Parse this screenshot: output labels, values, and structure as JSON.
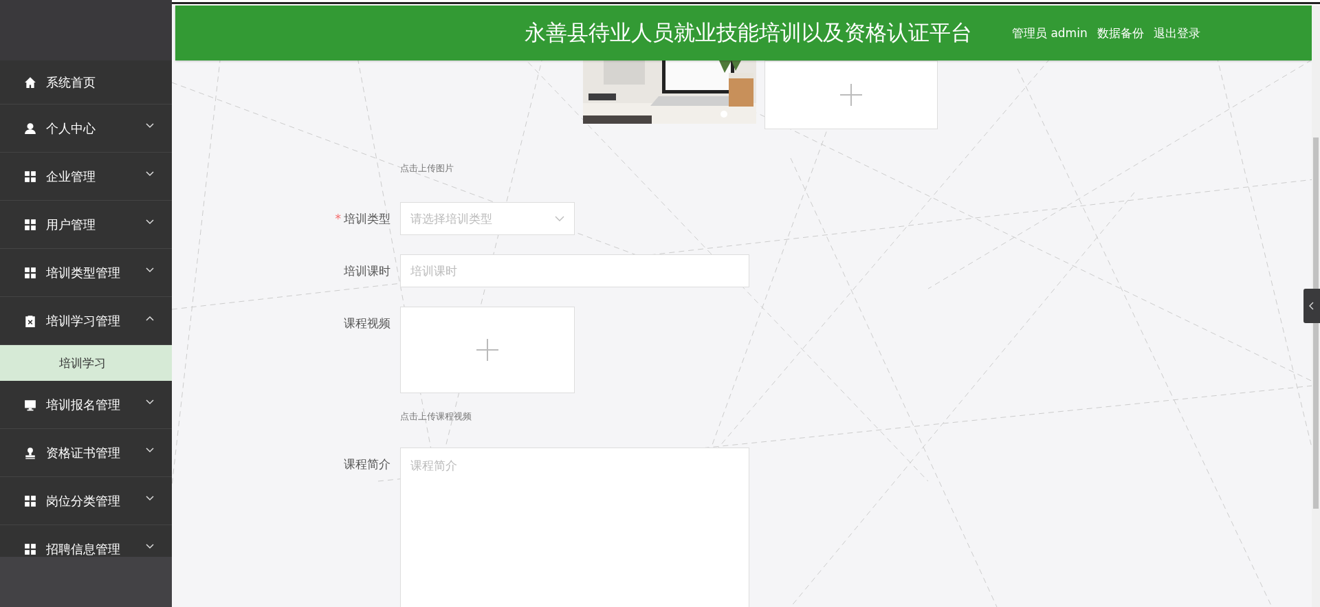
{
  "header": {
    "title": "永善县待业人员就业技能培训以及资格认证平台",
    "links": [
      "管理员 admin",
      "数据备份",
      "退出登录"
    ]
  },
  "sidebar": {
    "items": [
      {
        "label": "系统首页",
        "kind": "home"
      },
      {
        "label": "个人中心",
        "kind": "user",
        "expanded": false
      },
      {
        "label": "企业管理",
        "kind": "grid",
        "expanded": false
      },
      {
        "label": "用户管理",
        "kind": "grid",
        "expanded": false
      },
      {
        "label": "培训类型管理",
        "kind": "grid",
        "expanded": false
      },
      {
        "label": "培训学习管理",
        "kind": "clipboard",
        "expanded": true,
        "children": [
          {
            "label": "培训学习",
            "selected": true
          }
        ]
      },
      {
        "label": "培训报名管理",
        "kind": "monitor",
        "expanded": false
      },
      {
        "label": "资格证书管理",
        "kind": "stamp",
        "expanded": false
      },
      {
        "label": "岗位分类管理",
        "kind": "grid",
        "expanded": false
      },
      {
        "label": "招聘信息管理",
        "kind": "grid",
        "expanded": false
      }
    ]
  },
  "form": {
    "fields": [
      {
        "kind": "image-upload",
        "hint": "点击上传图片"
      },
      {
        "kind": "select",
        "label": "培训类型",
        "required_mark": "*",
        "placeholder": "请选择培训类型"
      },
      {
        "kind": "input",
        "label": "培训课时",
        "placeholder": "培训课时"
      },
      {
        "kind": "video-upload",
        "label": "课程视频",
        "hint": "点击上传课程视频"
      },
      {
        "kind": "textarea",
        "label": "课程简介",
        "placeholder": "课程简介"
      }
    ]
  }
}
